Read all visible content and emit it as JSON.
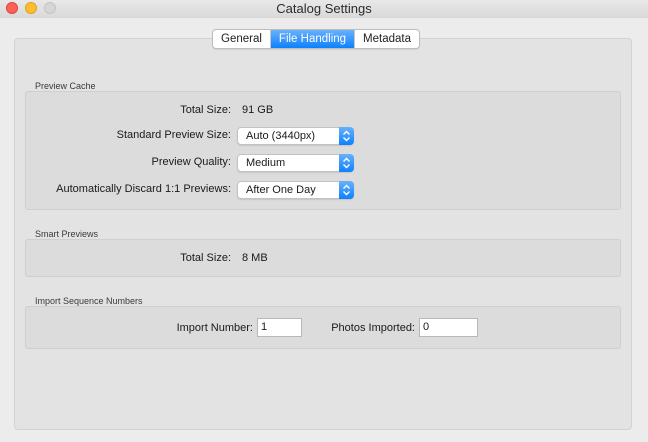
{
  "window": {
    "title": "Catalog Settings"
  },
  "tabs": [
    {
      "label": "General"
    },
    {
      "label": "File Handling"
    },
    {
      "label": "Metadata"
    }
  ],
  "preview_cache": {
    "section_label": "Preview Cache",
    "total_size_label": "Total Size:",
    "total_size_value": "91 GB",
    "standard_preview_size_label": "Standard Preview Size:",
    "standard_preview_size_value": "Auto (3440px)",
    "preview_quality_label": "Preview Quality:",
    "preview_quality_value": "Medium",
    "auto_discard_label": "Automatically Discard 1:1 Previews:",
    "auto_discard_value": "After One Day"
  },
  "smart_previews": {
    "section_label": "Smart Previews",
    "total_size_label": "Total Size:",
    "total_size_value": "8 MB"
  },
  "import_sequence": {
    "section_label": "Import Sequence Numbers",
    "import_number_label": "Import Number:",
    "import_number_value": "1",
    "photos_imported_label": "Photos Imported:",
    "photos_imported_value": "0"
  },
  "colors": {
    "accent": "#0d81ff",
    "close": "#fe5f57",
    "minimize": "#febc2e"
  }
}
